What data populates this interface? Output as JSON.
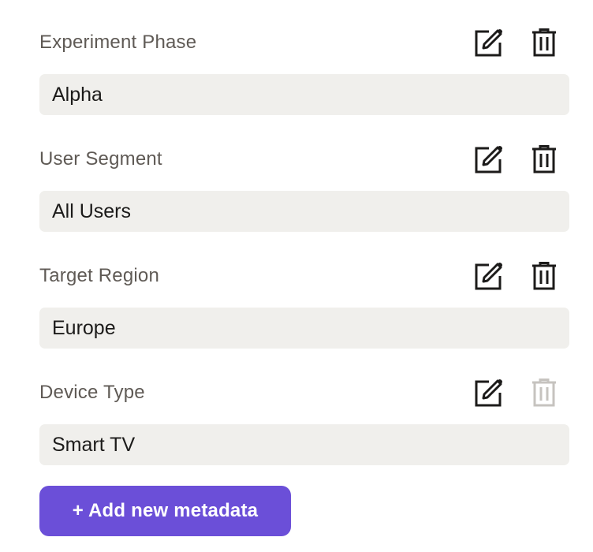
{
  "metadata_items": [
    {
      "label": "Experiment Phase",
      "value": "Alpha",
      "delete_enabled": true
    },
    {
      "label": "User Segment",
      "value": "All Users",
      "delete_enabled": true
    },
    {
      "label": "Target Region",
      "value": "Europe",
      "delete_enabled": true
    },
    {
      "label": "Device Type",
      "value": "Smart TV",
      "delete_enabled": false
    }
  ],
  "actions": {
    "add_label": "+ Add new metadata"
  },
  "icons": {
    "edit": "edit-icon",
    "delete": "trash-icon"
  },
  "colors": {
    "accent": "#6b4fd8",
    "icon": "#1c1b1a",
    "icon_disabled": "#c6c3bf",
    "field_bg": "#f0efec",
    "label": "#5f5a55"
  }
}
